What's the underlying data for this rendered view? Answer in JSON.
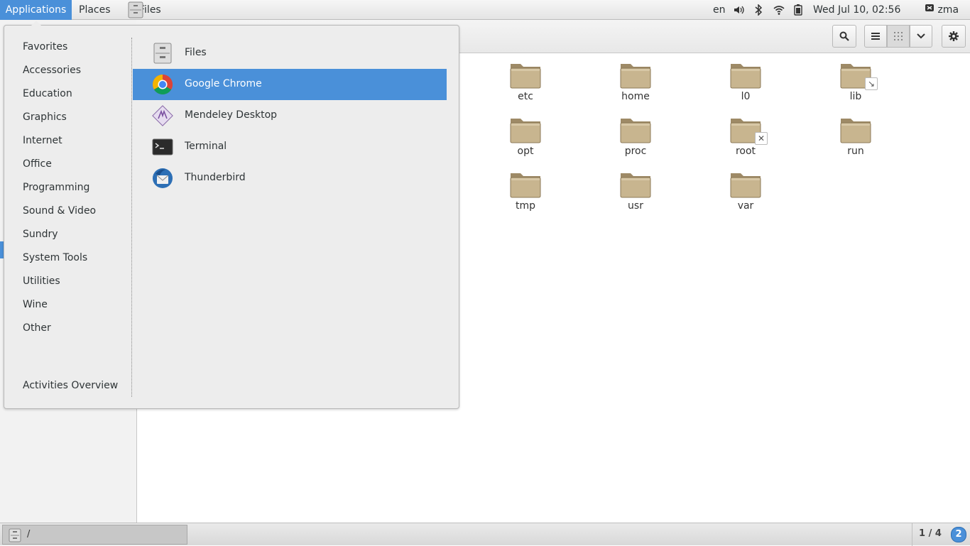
{
  "top_panel": {
    "applications": "Applications",
    "places": "Places",
    "files": "Files",
    "language": "en",
    "clock": "Wed Jul 10, 02:56",
    "user": "zma",
    "icons": [
      "volume-icon",
      "bluetooth-icon",
      "wifi-icon",
      "battery-icon",
      "user-status-icon"
    ]
  },
  "menu": {
    "categories": [
      "Favorites",
      "Accessories",
      "Education",
      "Graphics",
      "Internet",
      "Office",
      "Programming",
      "Sound & Video",
      "Sundry",
      "System Tools",
      "Utilities",
      "Wine",
      "Other"
    ],
    "activities": "Activities Overview",
    "apps": [
      {
        "label": "Files",
        "icon": "file-cabinet-icon"
      },
      {
        "label": "Google Chrome",
        "icon": "chrome-icon",
        "selected": true
      },
      {
        "label": "Mendeley Desktop",
        "icon": "mendeley-icon"
      },
      {
        "label": "Terminal",
        "icon": "terminal-icon"
      },
      {
        "label": "Thunderbird",
        "icon": "thunderbird-icon"
      }
    ]
  },
  "folders": [
    {
      "name": "etc"
    },
    {
      "name": "home"
    },
    {
      "name": "l0"
    },
    {
      "name": "lib",
      "emblem": "symlink"
    },
    {
      "name": "opt"
    },
    {
      "name": "proc"
    },
    {
      "name": "root",
      "emblem": "no-access"
    },
    {
      "name": "run"
    },
    {
      "name": "tmp"
    },
    {
      "name": "usr"
    },
    {
      "name": "var"
    }
  ],
  "bottom_bar": {
    "task_label": "/",
    "workspace": "1 / 4",
    "badge": "2"
  },
  "colors": {
    "accent": "#4a90d9",
    "folder": "#c8b58f"
  }
}
